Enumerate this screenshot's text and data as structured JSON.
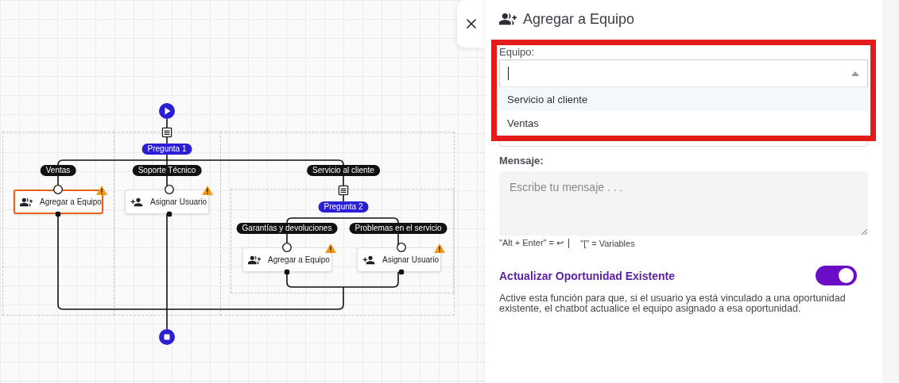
{
  "flow": {
    "questions": [
      {
        "label": "Pregunta 1"
      },
      {
        "label": "Pregunta 2"
      }
    ],
    "branches": [
      {
        "label": "Ventas"
      },
      {
        "label": "Soporte Técnico"
      },
      {
        "label": "Servicio al cliente"
      },
      {
        "label": "Garantías y devoluciones"
      },
      {
        "label": "Problemas en el servicio"
      }
    ],
    "nodes": [
      {
        "label": "Agregar a Equipo",
        "kind": "team",
        "selected": true,
        "warning": true
      },
      {
        "label": "Asignar Usuario",
        "kind": "user",
        "selected": false,
        "warning": true
      },
      {
        "label": "Agregar a Equipo",
        "kind": "team",
        "selected": false,
        "warning": true
      },
      {
        "label": "Asignar Usuario",
        "kind": "user",
        "selected": false,
        "warning": true
      }
    ]
  },
  "panel": {
    "title": "Agregar a Equipo",
    "team": {
      "label": "Equipo:",
      "options": [
        {
          "label": "Servicio al cliente",
          "selected": true
        },
        {
          "label": "Ventas",
          "selected": false
        }
      ]
    },
    "message": {
      "label": "Mensaje:",
      "placeholder": "Escribe tu mensaje . . ."
    },
    "hints": [
      "\"Alt + Enter\" = ↩",
      "\"[\" = Variables"
    ],
    "toggle": {
      "label": "Actualizar Oportunidad Existente",
      "on": true
    },
    "description": "Active esta función para que, si el usuario ya está vinculado a una oportunidad existente, el chatbot actualice el equipo asignado a esa oportunidad."
  }
}
